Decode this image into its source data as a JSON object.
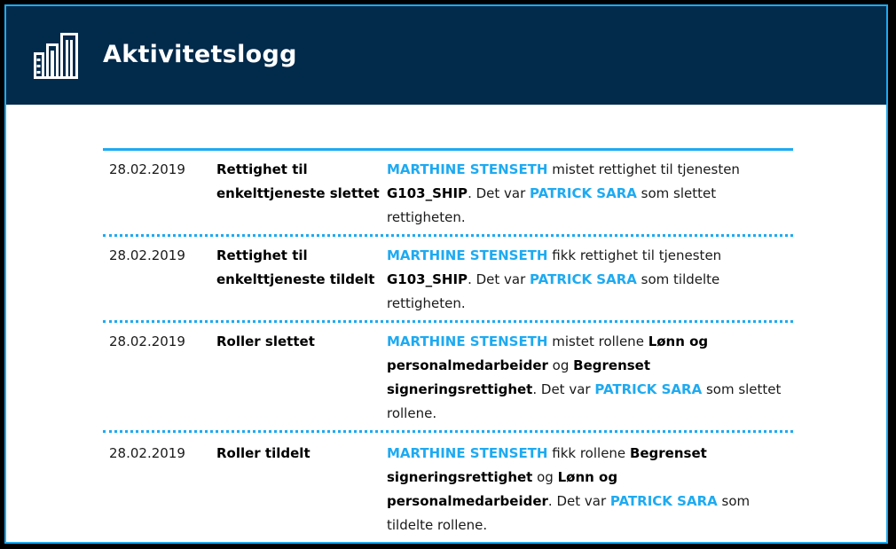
{
  "header": {
    "title": "Aktivitetslogg",
    "icon": "building-icon",
    "background_color": "#022a4b",
    "accent_color": "#1eaaf1"
  },
  "log": [
    {
      "date": "28.02.2019",
      "type": "Rettighet til\nenkelttjeneste slettet",
      "segments": [
        {
          "text": "MARTHINE STENSETH",
          "style": "hl"
        },
        {
          "text": " mistet rettighet til tjenesten ",
          "style": "normal"
        },
        {
          "text": "G103_SHIP",
          "style": "bold"
        },
        {
          "text": ". Det var ",
          "style": "normal"
        },
        {
          "text": "PATRICK SARA",
          "style": "hl"
        },
        {
          "text": " som slettet rettigheten.",
          "style": "normal"
        }
      ]
    },
    {
      "date": "28.02.2019",
      "type": "Rettighet til\nenkelttjeneste tildelt",
      "segments": [
        {
          "text": "MARTHINE STENSETH",
          "style": "hl"
        },
        {
          "text": " fikk rettighet til tjenesten ",
          "style": "normal"
        },
        {
          "text": "G103_SHIP",
          "style": "bold"
        },
        {
          "text": ". Det var ",
          "style": "normal"
        },
        {
          "text": "PATRICK SARA",
          "style": "hl"
        },
        {
          "text": " som tildelte rettigheten.",
          "style": "normal"
        }
      ]
    },
    {
      "date": "28.02.2019",
      "type": "Roller slettet",
      "segments": [
        {
          "text": "MARTHINE STENSETH",
          "style": "hl"
        },
        {
          "text": " mistet rollene ",
          "style": "normal"
        },
        {
          "text": "Lønn og personalmedarbeider",
          "style": "bold"
        },
        {
          "text": " og ",
          "style": "normal"
        },
        {
          "text": "Begrenset signeringsrettighet",
          "style": "bold"
        },
        {
          "text": ". Det var ",
          "style": "normal"
        },
        {
          "text": "PATRICK SARA",
          "style": "hl"
        },
        {
          "text": " som slettet rollene.",
          "style": "normal"
        }
      ]
    },
    {
      "date": "28.02.2019",
      "type": "Roller tildelt",
      "segments": [
        {
          "text": "MARTHINE STENSETH",
          "style": "hl"
        },
        {
          "text": " fikk rollene ",
          "style": "normal"
        },
        {
          "text": "Begrenset signeringsrettighet",
          "style": "bold"
        },
        {
          "text": " og ",
          "style": "normal"
        },
        {
          "text": "Lønn og personalmedarbeider",
          "style": "bold"
        },
        {
          "text": ". Det var ",
          "style": "normal"
        },
        {
          "text": "PATRICK SARA",
          "style": "hl"
        },
        {
          "text": " som tildelte rollene.",
          "style": "normal"
        }
      ]
    }
  ]
}
